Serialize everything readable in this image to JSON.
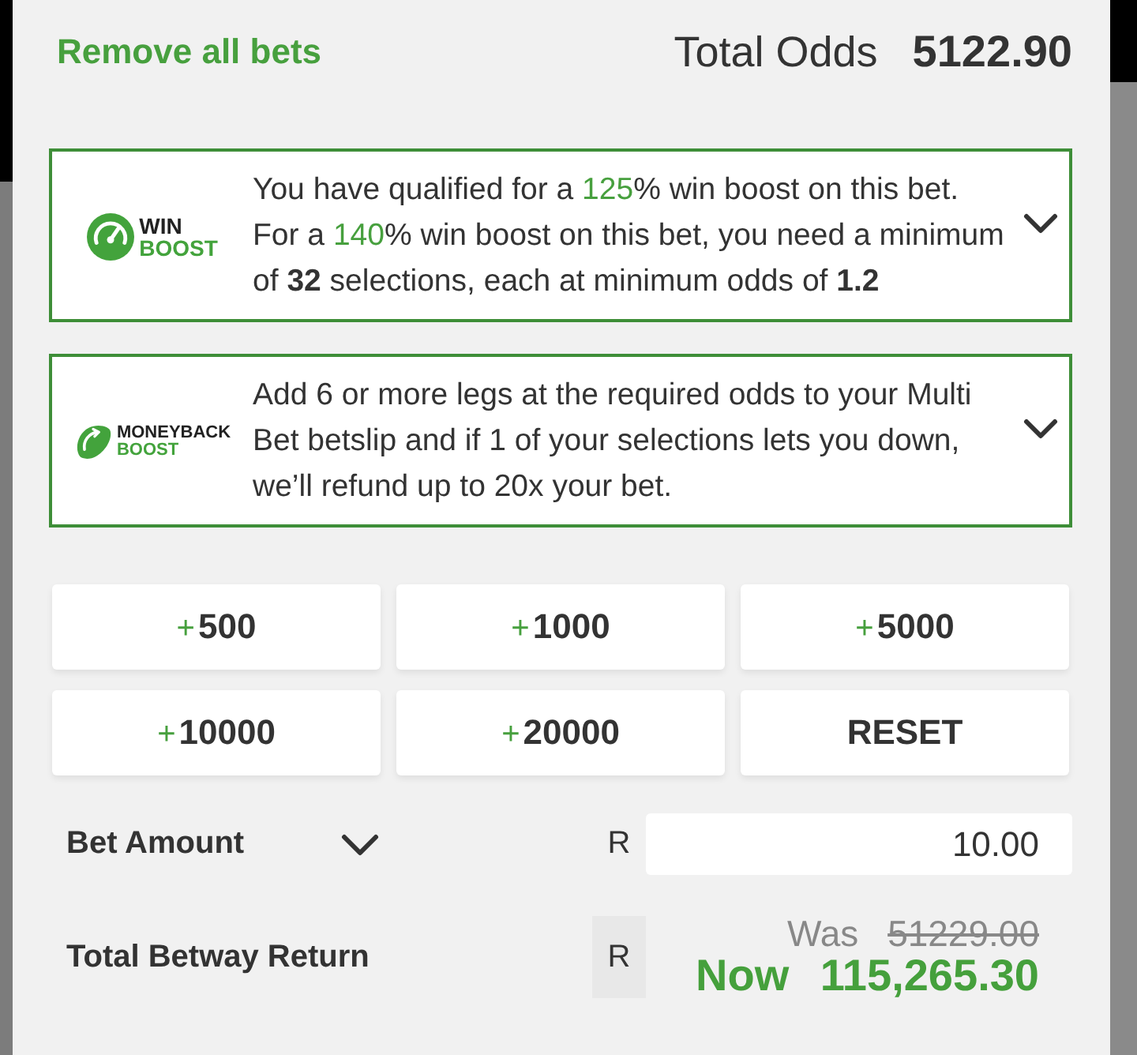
{
  "header": {
    "remove_all": "Remove all bets",
    "total_odds_label": "Total Odds",
    "total_odds_value": "5122.90"
  },
  "boosts": [
    {
      "kind": "win",
      "logo": [
        "WIN",
        "BOOST"
      ],
      "expanded": false,
      "sentences": [
        {
          "parts": [
            {
              "kind": "plain",
              "text": "You have qualified for a "
            },
            {
              "kind": "percent",
              "text": "125"
            },
            {
              "kind": "plain",
              "text": "% win boost on this bet."
            }
          ]
        },
        {
          "parts": [
            {
              "kind": "plain",
              "text": "For a "
            },
            {
              "kind": "percent",
              "text": "140"
            },
            {
              "kind": "plain",
              "text": "% win boost on this bet, you need a minimum of "
            },
            {
              "kind": "figure",
              "text": "32"
            },
            {
              "kind": "plain",
              "text": " selections, each at minimum odds of "
            },
            {
              "kind": "figure",
              "text": "1.2"
            }
          ]
        }
      ]
    },
    {
      "kind": "moneyback",
      "logo": [
        "MONEYBACK",
        "BOOST"
      ],
      "expanded": false,
      "sentences": [
        {
          "parts": [
            {
              "kind": "plain",
              "text": "Add 6 or more legs at the required odds to your Multi Bet betslip and if 1 of your selections lets you down, we’ll refund up to 20x your bet."
            }
          ]
        }
      ]
    }
  ],
  "quick_stakes": [
    {
      "kind": "add",
      "sign": "+",
      "amount": "500"
    },
    {
      "kind": "add",
      "sign": "+",
      "amount": "1000"
    },
    {
      "kind": "add",
      "sign": "+",
      "amount": "5000"
    },
    {
      "kind": "add",
      "sign": "+",
      "amount": "10000"
    },
    {
      "kind": "add",
      "sign": "+",
      "amount": "20000"
    },
    {
      "kind": "reset",
      "label": "RESET"
    }
  ],
  "bet_amount": {
    "label": "Bet Amount",
    "expanded": false,
    "currency": "R",
    "value": "10.00"
  },
  "total_return": {
    "label": "Total Betway Return",
    "currency": "R",
    "was_label": "Was",
    "was_value": "51229.00",
    "now_label": "Now",
    "now_value": "115,265.30"
  }
}
